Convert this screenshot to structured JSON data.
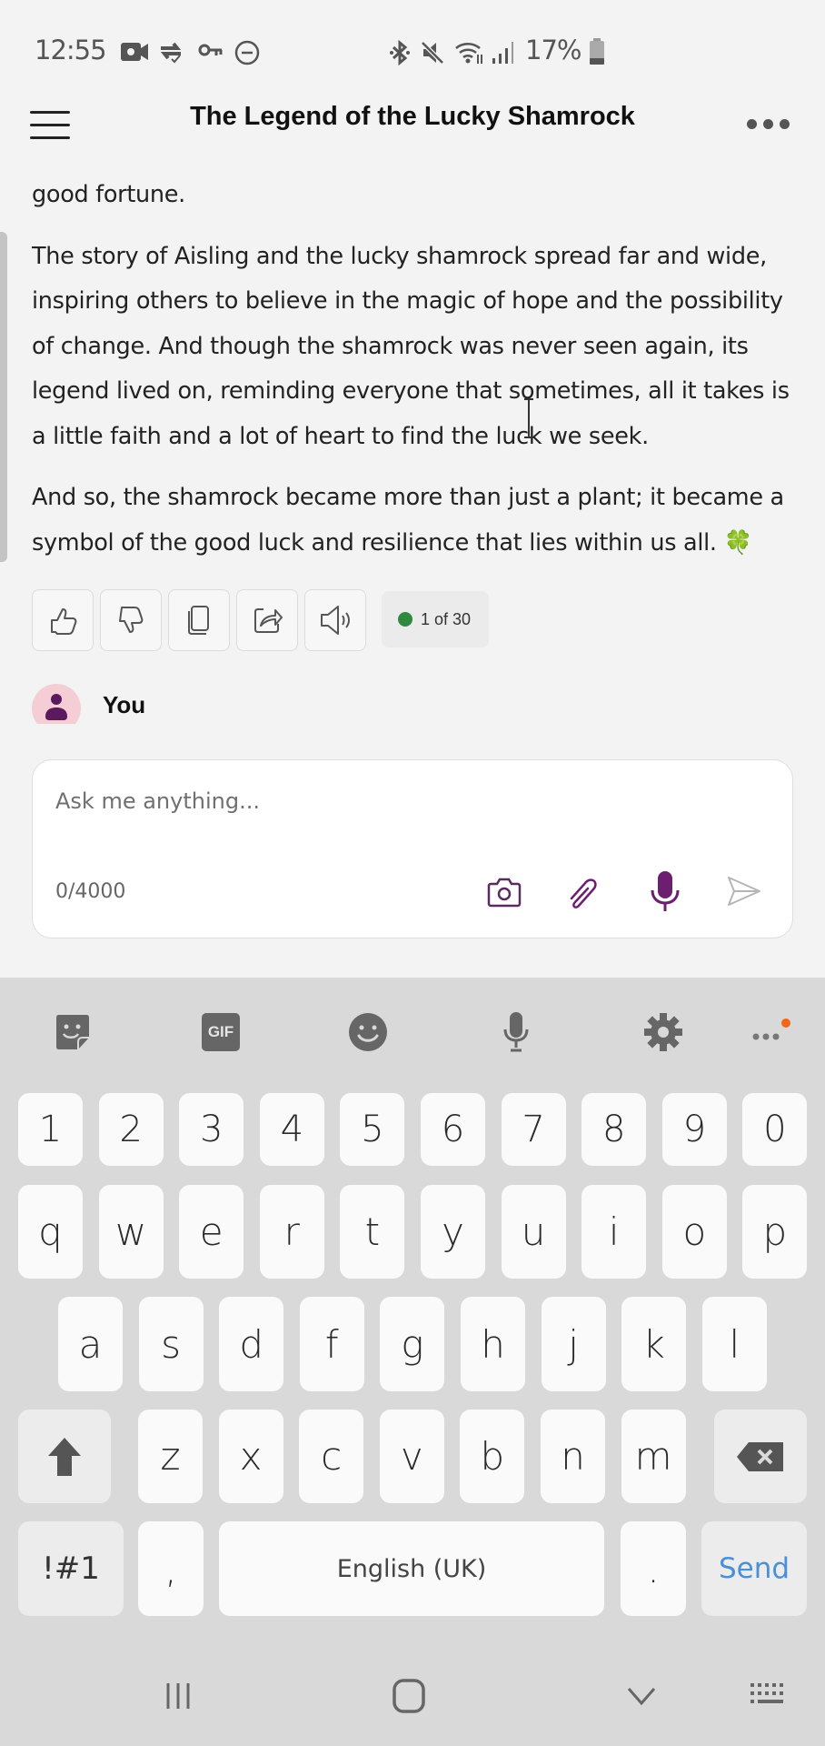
{
  "status_bar": {
    "time": "12:55",
    "battery_percent": "17%",
    "left_icons": [
      "video-recording-icon",
      "sync-icon",
      "vpn-key-icon",
      "do-not-disturb-icon"
    ],
    "right_icons": [
      "bluetooth-icon",
      "mute-icon",
      "wifi-icon",
      "signal-icon",
      "battery-icon"
    ]
  },
  "header": {
    "title": "The Legend of the Lucky Shamrock",
    "menu_icon": "hamburger-icon",
    "more_icon": "more-dots-icon"
  },
  "message": {
    "paragraphs": [
      "good fortune.",
      "The story of Aisling and the lucky shamrock spread far and wide, inspiring others to believe in the magic of hope and the possibility of change. And though the shamrock was never seen again, its legend lived on, reminding everyone that sometimes, all it takes is a little faith and a lot of heart to find the luck we seek.",
      "And so, the shamrock became more than just a plant; it became a symbol of the good luck and resilience that lies within us all. 🍀"
    ],
    "actions": [
      {
        "name": "like",
        "icon": "thumbs-up-icon"
      },
      {
        "name": "dislike",
        "icon": "thumbs-down-icon"
      },
      {
        "name": "copy",
        "icon": "copy-icon"
      },
      {
        "name": "share",
        "icon": "share-icon"
      },
      {
        "name": "read-aloud",
        "icon": "speaker-icon"
      }
    ],
    "variant_badge": "1 of 30",
    "variant_status_color": "#2e8b3e"
  },
  "user": {
    "name": "You"
  },
  "composer": {
    "value": "",
    "placeholder": "Ask me anything...",
    "char_count": "0/4000",
    "accent_color": "#6b1f6e"
  },
  "keyboard": {
    "toolbar": [
      "sticker-icon",
      "gif-icon",
      "emoji-icon",
      "voice-input-icon",
      "settings-icon",
      "more-icon"
    ],
    "gif_label": "GIF",
    "number_row": [
      "1",
      "2",
      "3",
      "4",
      "5",
      "6",
      "7",
      "8",
      "9",
      "0"
    ],
    "row1": [
      "q",
      "w",
      "e",
      "r",
      "t",
      "y",
      "u",
      "i",
      "o",
      "p"
    ],
    "row2": [
      "a",
      "s",
      "d",
      "f",
      "g",
      "h",
      "j",
      "k",
      "l"
    ],
    "row3": [
      "z",
      "x",
      "c",
      "v",
      "b",
      "n",
      "m"
    ],
    "symbols_key": "!#1",
    "comma_key": ",",
    "space_key": "English (UK)",
    "period_key": ".",
    "send_key": "Send"
  },
  "nav_bar": [
    "recent-apps-icon",
    "home-icon",
    "back-icon",
    "keyboard-switch-icon"
  ]
}
